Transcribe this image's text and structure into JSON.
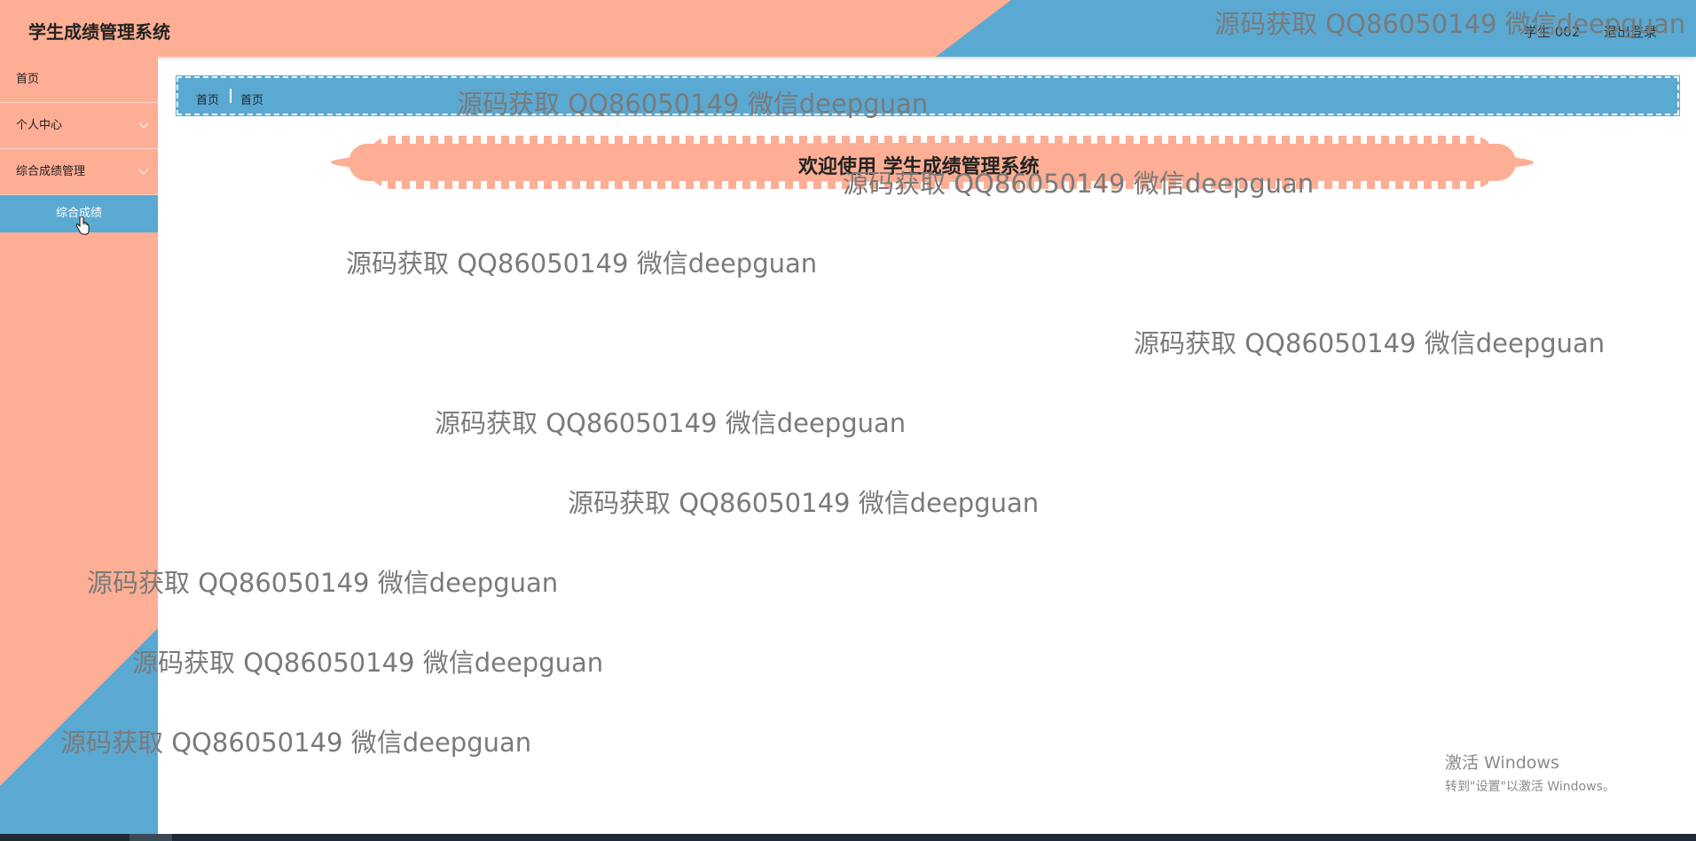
{
  "header": {
    "title": "学生成绩管理系统",
    "user": "学生 002",
    "logout": "退出登录"
  },
  "sidebar": {
    "items": [
      {
        "label": "首页"
      },
      {
        "label": "个人中心"
      },
      {
        "label": "综合成绩管理"
      }
    ],
    "subitem": {
      "label": "综合成绩"
    }
  },
  "breadcrumb": [
    "首页",
    "首页"
  ],
  "welcome": "欢迎使用 学生成绩管理系统",
  "watermark": "源码获取 QQ86050149 微信deepguan",
  "windows_activation": {
    "title": "激活 Windows",
    "subtitle": "转到\"设置\"以激活 Windows。"
  },
  "colors": {
    "salmon": "#fdae94",
    "blue": "#5aa9d2"
  }
}
